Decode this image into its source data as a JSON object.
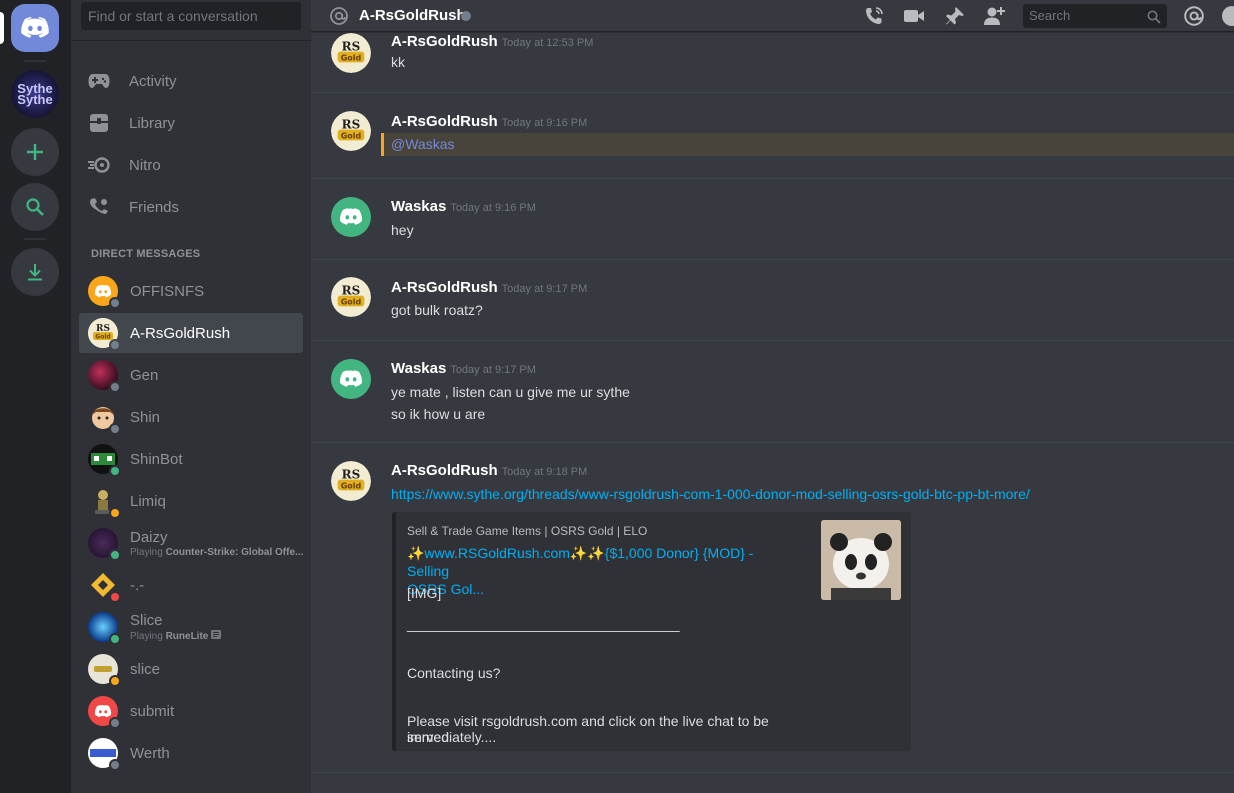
{
  "sidebar": {
    "search_placeholder": "Find or start a conversation",
    "nav": [
      {
        "label": "Activity",
        "icon": "gamepad-icon"
      },
      {
        "label": "Library",
        "icon": "library-icon"
      },
      {
        "label": "Nitro",
        "icon": "nitro-icon"
      },
      {
        "label": "Friends",
        "icon": "friends-icon"
      }
    ],
    "dm_header": "DIRECT MESSAGES",
    "dms": [
      {
        "name": "OFFISNFS",
        "status": "offline",
        "sub": ""
      },
      {
        "name": "A-RsGoldRush",
        "status": "offline",
        "sub": "",
        "active": true
      },
      {
        "name": "Gen",
        "status": "offline",
        "sub": ""
      },
      {
        "name": "Shin",
        "status": "offline",
        "sub": ""
      },
      {
        "name": "ShinBot",
        "status": "online",
        "sub": ""
      },
      {
        "name": "Limiq",
        "status": "idle",
        "sub": ""
      },
      {
        "name": "Daizy",
        "status": "online",
        "sub_prefix": "Playing ",
        "sub_game": "Counter-Strike: Global Offe..."
      },
      {
        "name": "-.-",
        "status": "dnd",
        "sub": ""
      },
      {
        "name": "Slice",
        "status": "online",
        "sub_prefix": "Playing ",
        "sub_game": "RuneLite"
      },
      {
        "name": "slice",
        "status": "idle",
        "sub": ""
      },
      {
        "name": "submit",
        "status": "offline",
        "sub": ""
      },
      {
        "name": "Werth",
        "status": "offline",
        "sub": ""
      }
    ]
  },
  "rail": {
    "guild_label_1": "Sythe",
    "guild_label_2": "Sythe"
  },
  "header": {
    "title": "A-RsGoldRush",
    "search_placeholder": "Search"
  },
  "messages": [
    {
      "author": "A-RsGoldRush",
      "time": "Today at 12:53 PM",
      "lines": [
        "kk"
      ]
    },
    {
      "author": "A-RsGoldRush",
      "time": "Today at 9:16 PM",
      "mention": "@Waskas"
    },
    {
      "author": "Waskas",
      "time": "Today at 9:16 PM",
      "lines": [
        "hey"
      ]
    },
    {
      "author": "A-RsGoldRush",
      "time": "Today at 9:17 PM",
      "lines": [
        "got bulk roatz?"
      ]
    },
    {
      "author": "Waskas",
      "time": "Today at 9:17 PM",
      "lines": [
        "ye mate , listen can u give me ur sythe",
        "so ik how u are"
      ]
    },
    {
      "author": "A-RsGoldRush",
      "time": "Today at 9:18 PM",
      "link": "https://www.sythe.org/threads/www-rsgoldrush-com-1-000-donor-mod-selling-osrs-gold-btc-pp-bt-more/"
    }
  ],
  "embed": {
    "provider": "Sell & Trade Game Items | OSRS Gold | ELO",
    "title_line_1": "✨www.RSGoldRush.com✨✨{$1,000 Donor} {MOD} - Selling",
    "title_line_2": "OSRS Gol...",
    "lines": [
      "[IMG]",
      "___________________________________",
      "Contacting us?",
      "Please visit rsgoldrush.com and click on the live chat to be served",
      "immediately...."
    ]
  },
  "colors": {
    "accent": "#7289da",
    "link": "#00b0f4",
    "mention_bar": "#faa61a",
    "online": "#43b581",
    "idle": "#faa61a",
    "dnd": "#f04747",
    "offline": "#747f8d"
  }
}
